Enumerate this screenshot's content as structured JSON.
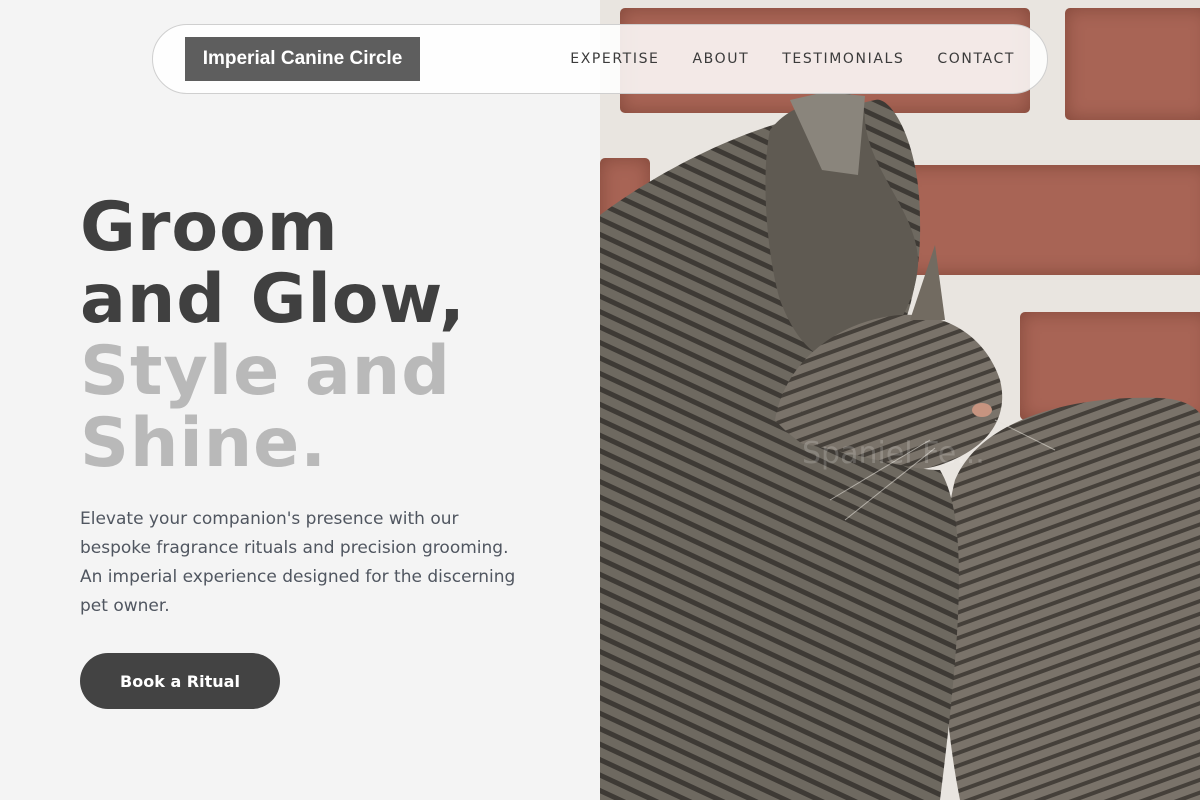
{
  "brand": {
    "name": "Imperial Canine Circle"
  },
  "nav": {
    "items": [
      {
        "label": "EXPERTISE"
      },
      {
        "label": "ABOUT"
      },
      {
        "label": "TESTIMONIALS"
      },
      {
        "label": "CONTACT"
      }
    ]
  },
  "hero": {
    "headline": {
      "line1": "Groom",
      "line2": "and Glow,",
      "line3": "Style and",
      "line4": "Shine."
    },
    "description": "Elevate your companion's presence with our bespoke fragrance rituals and precision grooming. An imperial experience designed for the discerning pet owner.",
    "cta_label": "Book a Ritual",
    "image_watermark": "Spaniel Fe..."
  },
  "colors": {
    "background": "#f4f4f4",
    "brand_bg": "#5e5e5e",
    "headline_dark": "#404040",
    "headline_light": "#b9b9b9",
    "body_text": "#505660",
    "cta_bg": "#434343"
  }
}
